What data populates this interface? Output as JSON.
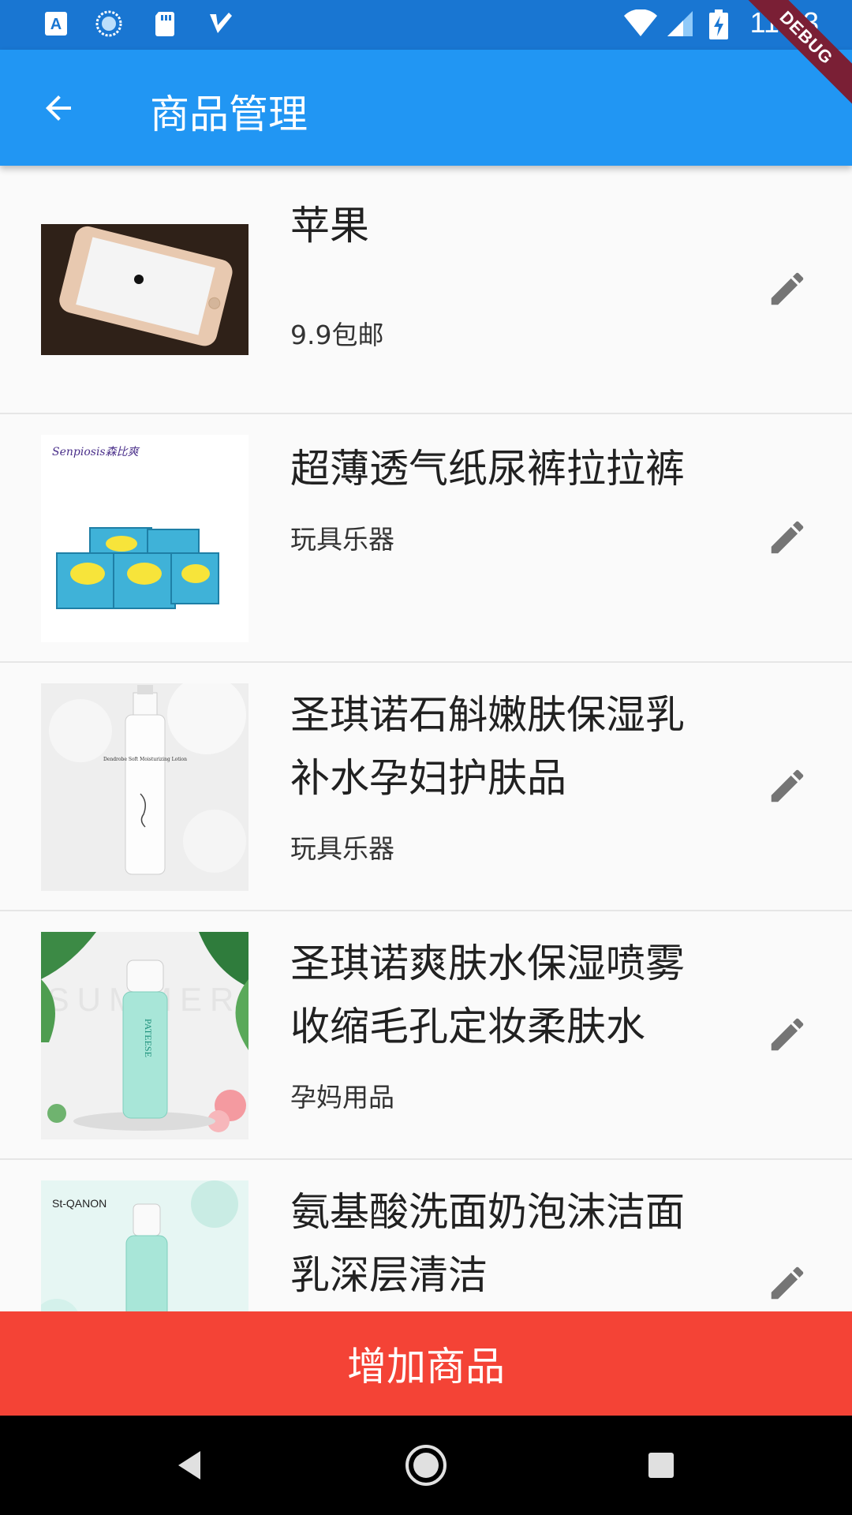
{
  "status_bar": {
    "time": "11:43",
    "icons": [
      "a-keyboard-icon",
      "sync-icon",
      "sd-card-icon",
      "check-icon",
      "wifi-icon",
      "signal-icon",
      "battery-charging-icon"
    ],
    "color": "#1976d2"
  },
  "debug_banner": "DEBUG",
  "app_bar": {
    "title": "商品管理",
    "back_icon": "arrow-back-icon",
    "color": "#2196f3"
  },
  "products": [
    {
      "name": "苹果",
      "subtitle": "9.9包邮",
      "image": "phone-image"
    },
    {
      "name": "超薄透气纸尿裤拉拉裤",
      "subtitle": "玩具乐器",
      "image": "diaper-image"
    },
    {
      "name": "圣琪诺石斛嫩肤保湿乳补水孕妇护肤品",
      "subtitle": "玩具乐器",
      "image": "lotion-image"
    },
    {
      "name": "圣琪诺爽肤水保湿喷雾收缩毛孔定妆柔肤水",
      "subtitle": "孕妈用品",
      "image": "toner-spray-image"
    },
    {
      "name": "氨基酸洗面奶泡沫洁面乳深层清洁",
      "subtitle": "",
      "image": "cleanser-image"
    }
  ],
  "image_text": {
    "diaper_brand": "Senpiosis森比爽",
    "lotion_label": "Dendrobe Soft Moisturizing Lotion",
    "toner_watermark": "SUMMER",
    "toner_brand": "PATEESE",
    "cleanser_brand": "St-QANON"
  },
  "add_button": {
    "label": "增加商品",
    "color": "#f44336"
  },
  "nav_bar": {
    "icons": [
      "back-triangle-icon",
      "home-circle-icon",
      "recents-square-icon"
    ]
  }
}
